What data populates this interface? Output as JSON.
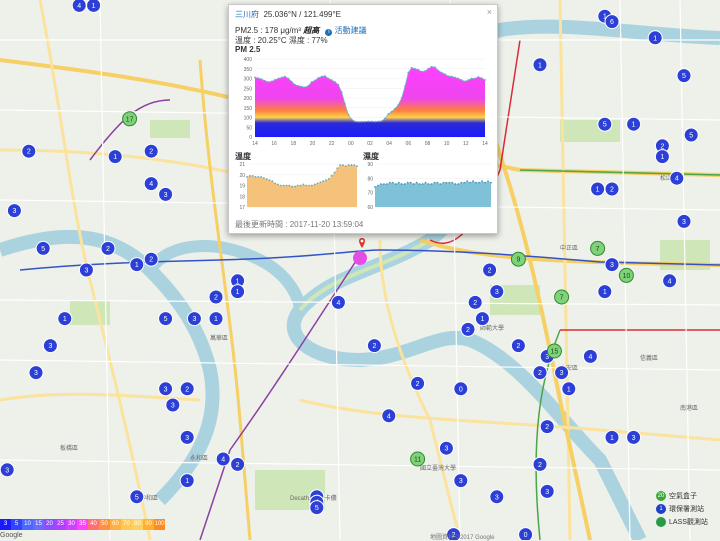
{
  "popup": {
    "site": "三川府",
    "coords": "25.036°N / 121.499°E",
    "close_label": "×",
    "pm_prefix": "PM2.5 : 178 μg/m³",
    "pm_level": "超高",
    "pm_link": "活動建議",
    "temp_humidity": "溫度 : 20.25°C  濕度 : 77%",
    "pm_chart_title": "PM 2.5",
    "pm_y_ticks": [
      "400",
      "350",
      "300",
      "250",
      "200",
      "150",
      "100",
      "50",
      "0"
    ],
    "pm_x_ticks": [
      "14",
      "16",
      "18",
      "20",
      "22",
      "00",
      "02",
      "04",
      "06",
      "08",
      "10",
      "12",
      "14"
    ],
    "temp_title": "溫度",
    "temp_y_ticks": [
      "21",
      "20",
      "19",
      "18",
      "17"
    ],
    "hum_title": "濕度",
    "hum_y_ticks": [
      "90",
      "80",
      "70",
      "60"
    ],
    "update_label": "最後更新時間 :",
    "update_time": "2017-11-20 13:59:04"
  },
  "legend_values": [
    "3",
    "5",
    "10",
    "15",
    "20",
    "25",
    "30",
    "35",
    "40",
    "50",
    "60",
    "70",
    "80",
    "90",
    "100"
  ],
  "legend_colors": [
    "#1a1aff",
    "#3344ff",
    "#4a67ff",
    "#6a6aff",
    "#8c4cff",
    "#b040ff",
    "#d040ff",
    "#ff40ff",
    "#ff7070",
    "#ff9040",
    "#ffb040",
    "#ffc850",
    "#ffd060",
    "#ffb030",
    "#ff8a20"
  ],
  "keybox": [
    {
      "count": "20",
      "label": "空氣盒子",
      "color": "#39a935"
    },
    {
      "count": "1",
      "label": "環保署測站",
      "color": "#1f3fc8"
    },
    {
      "count": "",
      "label": "LASS觀測站",
      "color": "#2a9a4a"
    }
  ],
  "copyright": "地圖資料 ©2017 Google",
  "google": "Google",
  "map_labels": [
    "新店區",
    "中正區",
    "大安區",
    "信義區",
    "板橋區",
    "永和區",
    "中和區",
    "萬華區",
    "Decathlon 迪卡儂",
    "國立臺灣大學",
    "師範大學",
    "松山區",
    "南港區"
  ],
  "stations": [
    {
      "label": "4",
      "type": "cluster",
      "lx": 0.11,
      "ly": 0.01
    },
    {
      "label": "1",
      "type": "cluster",
      "lx": 0.13,
      "ly": 0.01
    },
    {
      "label": "1",
      "type": "cluster",
      "lx": 0.84,
      "ly": 0.03
    },
    {
      "label": "6",
      "type": "cluster",
      "lx": 0.85,
      "ly": 0.04
    },
    {
      "label": "1",
      "type": "cluster",
      "lx": 0.91,
      "ly": 0.07
    },
    {
      "label": "1",
      "type": "cluster",
      "lx": 0.75,
      "ly": 0.12
    },
    {
      "label": "5",
      "type": "cluster",
      "lx": 0.95,
      "ly": 0.14
    },
    {
      "label": "17",
      "type": "box",
      "lx": 0.18,
      "ly": 0.22
    },
    {
      "label": "2",
      "type": "cluster",
      "lx": 0.04,
      "ly": 0.28
    },
    {
      "label": "1",
      "type": "cluster",
      "lx": 0.16,
      "ly": 0.29
    },
    {
      "label": "2",
      "type": "cluster",
      "lx": 0.21,
      "ly": 0.28
    },
    {
      "label": "5",
      "type": "cluster",
      "lx": 0.84,
      "ly": 0.23
    },
    {
      "label": "1",
      "type": "cluster",
      "lx": 0.88,
      "ly": 0.23
    },
    {
      "label": "5",
      "type": "cluster",
      "lx": 0.96,
      "ly": 0.25
    },
    {
      "label": "2",
      "type": "cluster",
      "lx": 0.92,
      "ly": 0.27
    },
    {
      "label": "1",
      "type": "cluster",
      "lx": 0.92,
      "ly": 0.29
    },
    {
      "label": "4",
      "type": "cluster",
      "lx": 0.21,
      "ly": 0.34
    },
    {
      "label": "3",
      "type": "cluster",
      "lx": 0.23,
      "ly": 0.36
    },
    {
      "label": "3",
      "type": "cluster",
      "lx": 0.02,
      "ly": 0.39
    },
    {
      "label": "4",
      "type": "cluster",
      "lx": 0.94,
      "ly": 0.33
    },
    {
      "label": "1",
      "type": "cluster",
      "lx": 0.83,
      "ly": 0.35
    },
    {
      "label": "2",
      "type": "cluster",
      "lx": 0.85,
      "ly": 0.35
    },
    {
      "label": "3",
      "type": "cluster",
      "lx": 0.68,
      "ly": 0.38
    },
    {
      "label": "3",
      "type": "cluster",
      "lx": 0.95,
      "ly": 0.41
    },
    {
      "label": "2",
      "type": "cluster",
      "lx": 0.15,
      "ly": 0.46
    },
    {
      "label": "5",
      "type": "cluster",
      "lx": 0.06,
      "ly": 0.46
    },
    {
      "label": "9",
      "type": "box",
      "lx": 0.72,
      "ly": 0.48
    },
    {
      "label": "7",
      "type": "box",
      "lx": 0.83,
      "ly": 0.46
    },
    {
      "label": "10",
      "type": "box",
      "lx": 0.87,
      "ly": 0.51
    },
    {
      "label": "3",
      "type": "cluster",
      "lx": 0.12,
      "ly": 0.5
    },
    {
      "label": "1",
      "type": "cluster",
      "lx": 0.19,
      "ly": 0.49
    },
    {
      "label": "2",
      "type": "cluster",
      "lx": 0.21,
      "ly": 0.48
    },
    {
      "label": "1",
      "type": "cluster",
      "lx": 0.33,
      "ly": 0.52
    },
    {
      "label": "1",
      "type": "cluster",
      "lx": 0.33,
      "ly": 0.54
    },
    {
      "label": "2",
      "type": "cluster",
      "lx": 0.3,
      "ly": 0.55
    },
    {
      "label": "4",
      "type": "cluster",
      "lx": 0.47,
      "ly": 0.56
    },
    {
      "label": "2",
      "type": "cluster",
      "lx": 0.68,
      "ly": 0.5
    },
    {
      "label": "3",
      "type": "cluster",
      "lx": 0.69,
      "ly": 0.54
    },
    {
      "label": "7",
      "type": "box",
      "lx": 0.78,
      "ly": 0.55
    },
    {
      "label": "1",
      "type": "cluster",
      "lx": 0.84,
      "ly": 0.54
    },
    {
      "label": "3",
      "type": "cluster",
      "lx": 0.85,
      "ly": 0.49
    },
    {
      "label": "4",
      "type": "cluster",
      "lx": 0.93,
      "ly": 0.52
    },
    {
      "label": "1",
      "type": "cluster",
      "lx": 0.09,
      "ly": 0.59
    },
    {
      "label": "5",
      "type": "cluster",
      "lx": 0.23,
      "ly": 0.59
    },
    {
      "label": "3",
      "type": "cluster",
      "lx": 0.27,
      "ly": 0.59
    },
    {
      "label": "1",
      "type": "cluster",
      "lx": 0.3,
      "ly": 0.59
    },
    {
      "label": "2",
      "type": "cluster",
      "lx": 0.66,
      "ly": 0.56
    },
    {
      "label": "2",
      "type": "cluster",
      "lx": 0.65,
      "ly": 0.61
    },
    {
      "label": "1",
      "type": "cluster",
      "lx": 0.67,
      "ly": 0.59
    },
    {
      "label": "3",
      "type": "cluster",
      "lx": 0.07,
      "ly": 0.64
    },
    {
      "label": "2",
      "type": "cluster",
      "lx": 0.52,
      "ly": 0.64
    },
    {
      "label": "3",
      "type": "cluster",
      "lx": 0.76,
      "ly": 0.66
    },
    {
      "label": "2",
      "type": "cluster",
      "lx": 0.72,
      "ly": 0.64
    },
    {
      "label": "15",
      "type": "box",
      "lx": 0.77,
      "ly": 0.65
    },
    {
      "label": "3",
      "type": "cluster",
      "lx": 0.05,
      "ly": 0.69
    },
    {
      "label": "3",
      "type": "cluster",
      "lx": 0.23,
      "ly": 0.72
    },
    {
      "label": "2",
      "type": "cluster",
      "lx": 0.26,
      "ly": 0.72
    },
    {
      "label": "2",
      "type": "cluster",
      "lx": 0.58,
      "ly": 0.71
    },
    {
      "label": "0",
      "type": "cluster",
      "lx": 0.64,
      "ly": 0.72
    },
    {
      "label": "2",
      "type": "cluster",
      "lx": 0.75,
      "ly": 0.69
    },
    {
      "label": "3",
      "type": "cluster",
      "lx": 0.78,
      "ly": 0.69
    },
    {
      "label": "4",
      "type": "cluster",
      "lx": 0.82,
      "ly": 0.66
    },
    {
      "label": "1",
      "type": "cluster",
      "lx": 0.79,
      "ly": 0.72
    },
    {
      "label": "3",
      "type": "cluster",
      "lx": 0.24,
      "ly": 0.75
    },
    {
      "label": "4",
      "type": "cluster",
      "lx": 0.54,
      "ly": 0.77
    },
    {
      "label": "3",
      "type": "cluster",
      "lx": 0.26,
      "ly": 0.81
    },
    {
      "label": "2",
      "type": "cluster",
      "lx": 0.76,
      "ly": 0.79
    },
    {
      "label": "3",
      "type": "cluster",
      "lx": 0.62,
      "ly": 0.83
    },
    {
      "label": "1",
      "type": "cluster",
      "lx": 0.85,
      "ly": 0.81
    },
    {
      "label": "3",
      "type": "cluster",
      "lx": 0.88,
      "ly": 0.81
    },
    {
      "label": "4",
      "type": "cluster",
      "lx": 0.31,
      "ly": 0.85
    },
    {
      "label": "2",
      "type": "cluster",
      "lx": 0.33,
      "ly": 0.86
    },
    {
      "label": "11",
      "type": "box",
      "lx": 0.58,
      "ly": 0.85
    },
    {
      "label": "3",
      "type": "cluster",
      "lx": 0.01,
      "ly": 0.87
    },
    {
      "label": "2",
      "type": "cluster",
      "lx": 0.75,
      "ly": 0.86
    },
    {
      "label": "1",
      "type": "cluster",
      "lx": 0.26,
      "ly": 0.89
    },
    {
      "label": "3",
      "type": "cluster",
      "lx": 0.64,
      "ly": 0.89
    },
    {
      "label": "3",
      "type": "cluster",
      "lx": 0.69,
      "ly": 0.92
    },
    {
      "label": "4",
      "type": "cluster",
      "lx": 0.44,
      "ly": 0.92
    },
    {
      "label": "5",
      "type": "cluster",
      "lx": 0.19,
      "ly": 0.92
    },
    {
      "label": "4",
      "type": "cluster",
      "lx": 0.44,
      "ly": 0.93
    },
    {
      "label": "5",
      "type": "cluster",
      "lx": 0.44,
      "ly": 0.94
    },
    {
      "label": "3",
      "type": "cluster",
      "lx": 0.76,
      "ly": 0.91
    },
    {
      "label": "2",
      "type": "cluster",
      "lx": 0.63,
      "ly": 0.99
    },
    {
      "label": "0",
      "type": "cluster",
      "lx": 0.73,
      "ly": 0.99
    }
  ],
  "pm_series": [
    305,
    302,
    296,
    288,
    282,
    285,
    293,
    300,
    305,
    310,
    300,
    284,
    268,
    262,
    258,
    255,
    262,
    282,
    290,
    303,
    310,
    313,
    300,
    292,
    282,
    268,
    230,
    170,
    115,
    90,
    80,
    78,
    79,
    79,
    80,
    80,
    79,
    80,
    82,
    95,
    118,
    130,
    145,
    165,
    200,
    260,
    330,
    355,
    350,
    345,
    335,
    338,
    350,
    360,
    358,
    340,
    330,
    322,
    312,
    310,
    305,
    300,
    292,
    285,
    292,
    300,
    300,
    308,
    302,
    292
  ],
  "temp_series": [
    19.8,
    19.9,
    19.9,
    19.8,
    19.8,
    19.8,
    19.7,
    19.6,
    19.5,
    19.4,
    19.2,
    19.1,
    19.0,
    19.0,
    19.0,
    19.0,
    18.9,
    18.9,
    19.0,
    19.0,
    19.1,
    19.0,
    19.0,
    19.0,
    19.1,
    19.2,
    19.3,
    19.4,
    19.5,
    19.6,
    19.9,
    20.2,
    20.6,
    20.9,
    20.9,
    20.8,
    20.9,
    20.9,
    20.9,
    20.8
  ],
  "hum_series": [
    74,
    75,
    76,
    76,
    76,
    77,
    77,
    76,
    77,
    76,
    76,
    77,
    77,
    76,
    77,
    76,
    76,
    77,
    76,
    76,
    77,
    77,
    76,
    77,
    77,
    77,
    77,
    76,
    76,
    77,
    77,
    78,
    77,
    78,
    77,
    77,
    78,
    77,
    78,
    77
  ]
}
